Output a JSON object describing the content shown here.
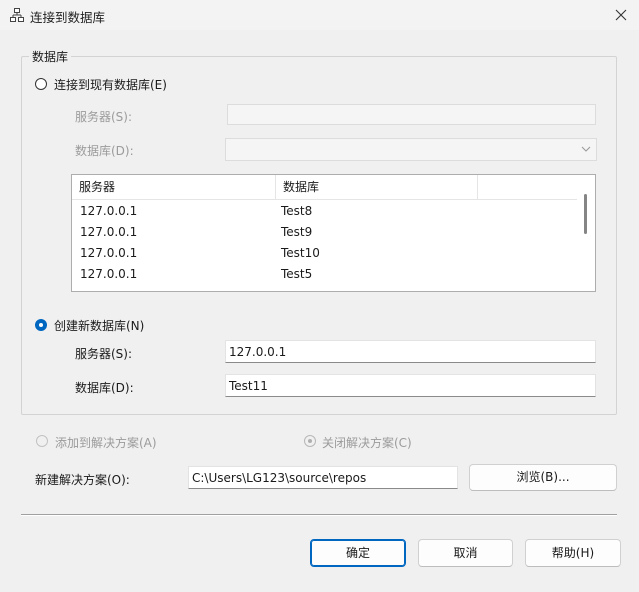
{
  "window": {
    "title": "连接到数据库",
    "icon": "database-connection-icon",
    "close": "close-icon"
  },
  "group": {
    "title": "数据库"
  },
  "existing": {
    "label": "连接到现有数据库(E)",
    "server_label": "服务器(S):",
    "server_value": "",
    "database_label": "数据库(D):",
    "database_value": "",
    "list": {
      "columns": [
        "服务器",
        "数据库",
        ""
      ],
      "rows": [
        {
          "server": "127.0.0.1",
          "database": "Test8"
        },
        {
          "server": "127.0.0.1",
          "database": "Test9"
        },
        {
          "server": "127.0.0.1",
          "database": "Test10"
        },
        {
          "server": "127.0.0.1",
          "database": "Test5"
        }
      ]
    }
  },
  "create": {
    "label": "创建新数据库(N)",
    "server_label": "服务器(S):",
    "server_value": "127.0.0.1",
    "database_label": "数据库(D):",
    "database_value": "Test11"
  },
  "solution": {
    "add_label": "添加到解决方案(A)",
    "close_label": "关闭解决方案(C)",
    "new_label": "新建解决方案(O):",
    "new_path": "C:\\Users\\LG123\\source\\repos",
    "browse": "浏览(B)..."
  },
  "buttons": {
    "ok": "确定",
    "cancel": "取消",
    "help": "帮助(H)"
  },
  "colors": {
    "accent": "#0067c0",
    "background": "#f0f0f0"
  }
}
